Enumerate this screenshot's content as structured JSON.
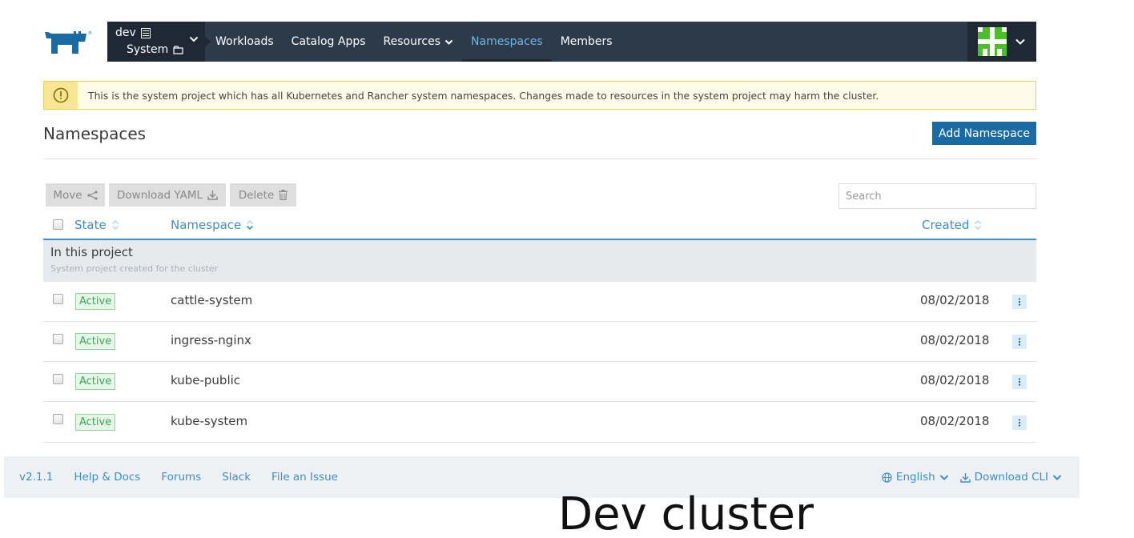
{
  "nav": {
    "cluster_name": "dev",
    "project_name": "System",
    "items": [
      {
        "label": "Workloads"
      },
      {
        "label": "Catalog Apps"
      },
      {
        "label": "Resources"
      },
      {
        "label": "Namespaces"
      },
      {
        "label": "Members"
      }
    ],
    "active_item": "Namespaces"
  },
  "banner": {
    "text": "This is the system project which has all Kubernetes and Rancher system namespaces. Changes made to resources in the system project may harm the cluster."
  },
  "page": {
    "title": "Namespaces",
    "add_button": "Add Namespace"
  },
  "toolbar": {
    "move": "Move",
    "download_yaml": "Download YAML",
    "delete": "Delete",
    "search_placeholder": "Search"
  },
  "table": {
    "headers": {
      "state": "State",
      "namespace": "Namespace",
      "created": "Created"
    },
    "group": {
      "name": "In this project",
      "description": "System project created for the cluster"
    },
    "rows": [
      {
        "state": "Active",
        "namespace": "cattle-system",
        "created": "08/02/2018"
      },
      {
        "state": "Active",
        "namespace": "ingress-nginx",
        "created": "08/02/2018"
      },
      {
        "state": "Active",
        "namespace": "kube-public",
        "created": "08/02/2018"
      },
      {
        "state": "Active",
        "namespace": "kube-system",
        "created": "08/02/2018"
      }
    ]
  },
  "footer": {
    "version": "v2.1.1",
    "links": [
      "Help & Docs",
      "Forums",
      "Slack",
      "File an Issue"
    ],
    "language": "English",
    "download_cli": "Download CLI"
  },
  "caption": "Dev cluster",
  "colors": {
    "nav_bg": "#2d3a4a",
    "accent": "#3d8ec9",
    "primary_button": "#1a6ba3",
    "active_badge": "#3aa656",
    "warning_border": "#f0d04a"
  }
}
